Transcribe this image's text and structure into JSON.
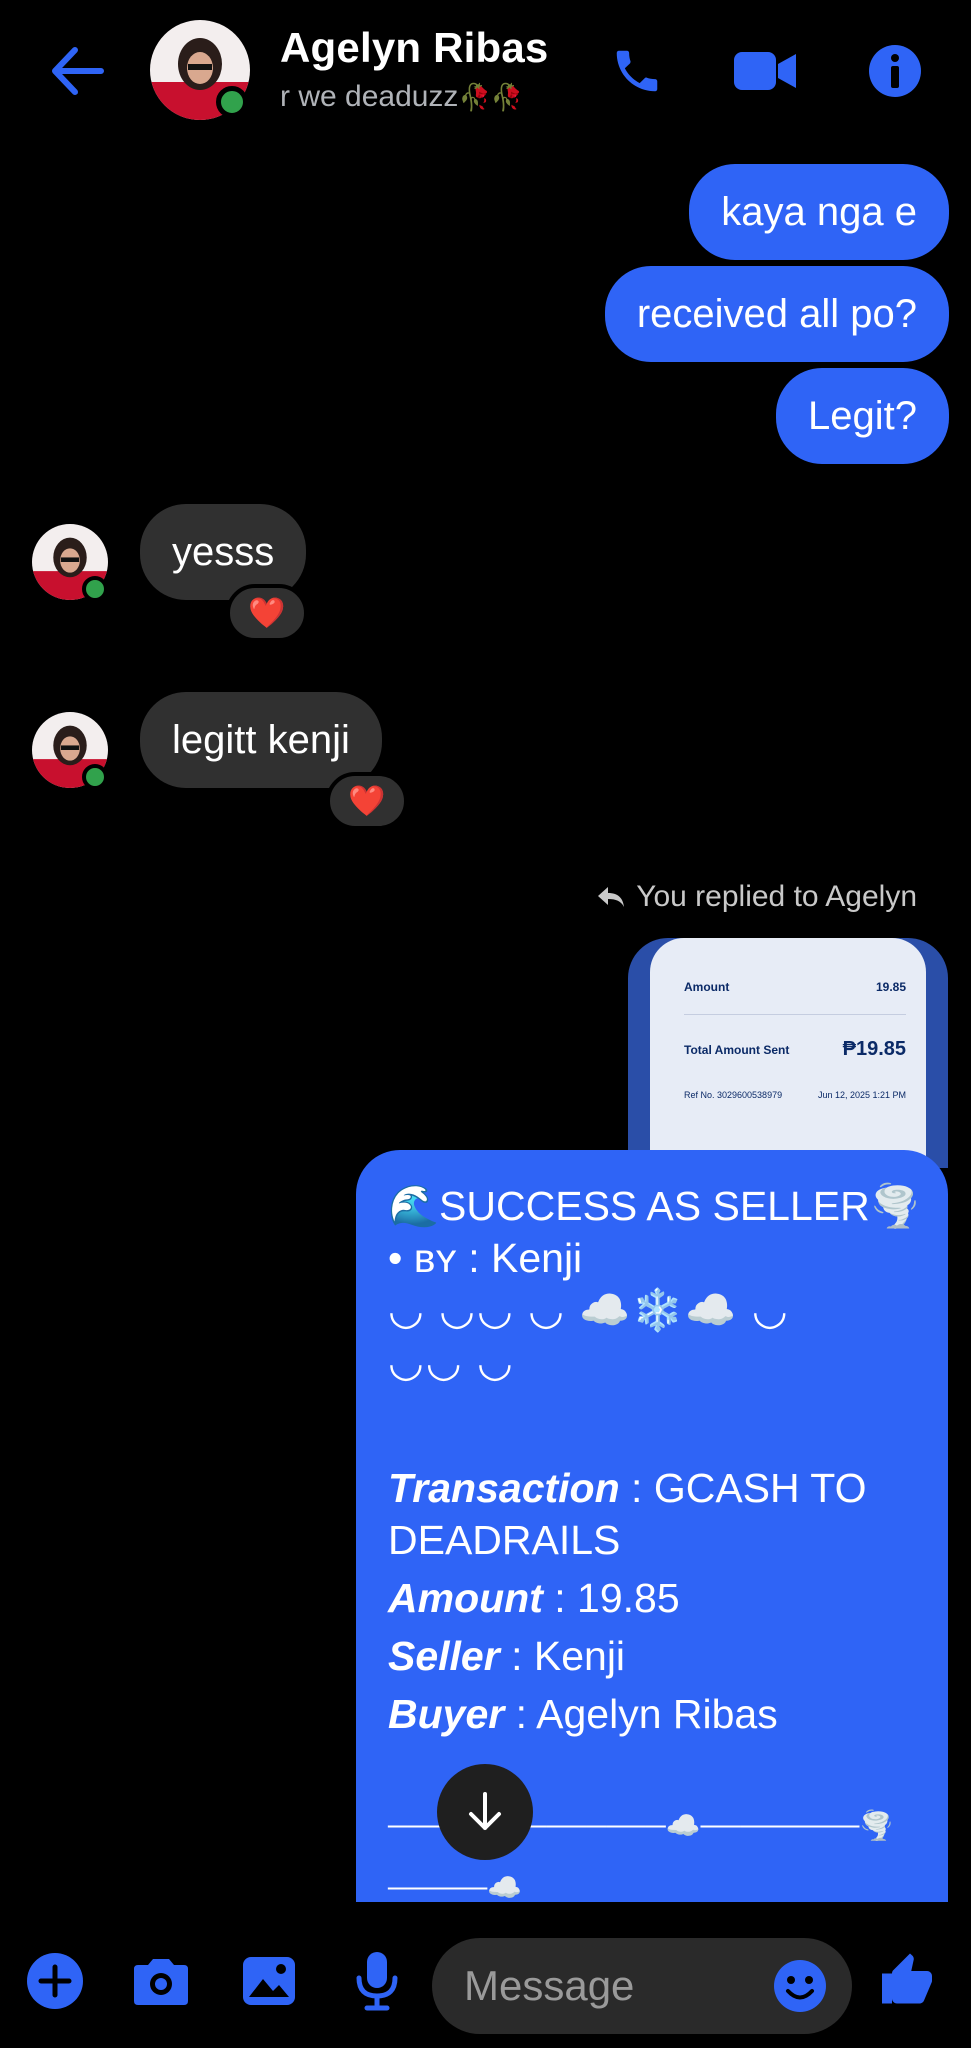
{
  "header": {
    "contact_name": "Agelyn Ribas",
    "status": "r we deaduzz",
    "status_emoji": "🥀🥀"
  },
  "messages": {
    "out1": "kaya nga e",
    "out2": "received all po?",
    "out3": "Legit?",
    "in1": "yesss",
    "in2": "legitt kenji",
    "reaction": "❤️"
  },
  "reply": {
    "note": "You replied to Agelyn",
    "preview": {
      "row1_label": "Amount",
      "row1_value": "19.85",
      "row2_label": "Total Amount Sent",
      "row2_value": "₱19.85",
      "row3_label": "Ref No. 3029600538979",
      "row3_value": "Jun 12, 2025 1:21 PM"
    }
  },
  "card": {
    "line1": "🌊SUCCESS AS SELLER🌪️",
    "line2": "• ʙʏ : Kenji",
    "line3": "◡ ◡◡ ◡ ☁️❄️☁️ ◡",
    "line4": "◡◡ ◡",
    "transaction_label": "Transaction",
    "transaction_value": " : GCASH TO",
    "transaction_value2": "DEADRAILS",
    "amount_label": "Amount",
    "amount_value": " : 19.85",
    "seller_label": "Seller",
    "seller_value": " : Kenji",
    "buyer_label": "Buyer",
    "buyer_value": " : Agelyn Ribas",
    "divider1": "──────────────☁️────────🌪️",
    "divider2": "─────☁️"
  },
  "composer": {
    "placeholder": "Message"
  },
  "colors": {
    "accent": "#2f64f6",
    "incoming_bubble": "#303030",
    "online": "#31a24c",
    "background": "#000000"
  },
  "icons": {
    "back": "arrow-left-icon",
    "call": "phone-icon",
    "video": "video-camera-icon",
    "info": "info-icon",
    "add": "plus-circle-icon",
    "camera": "camera-icon",
    "gallery": "image-icon",
    "mic": "microphone-icon",
    "emoji": "smiley-icon",
    "like": "thumbs-up-icon",
    "scroll": "arrow-down-icon"
  }
}
